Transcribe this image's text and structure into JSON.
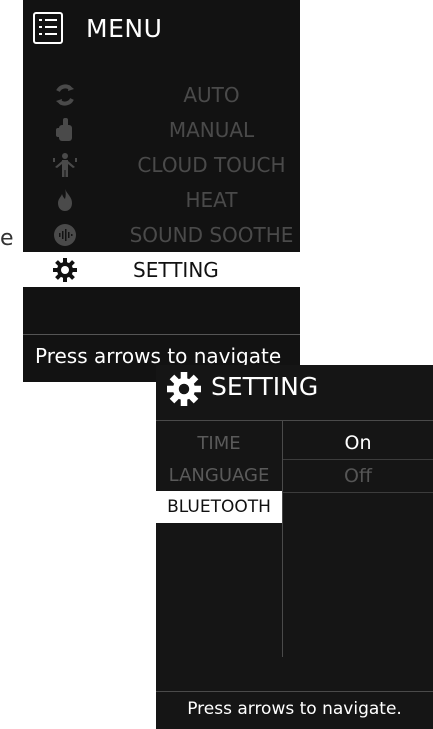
{
  "stray_char": "e",
  "menu": {
    "title": "MENU",
    "icon": "list-icon",
    "items": [
      {
        "label": "AUTO",
        "icon": "refresh-cycle-icon",
        "selected": false
      },
      {
        "label": "MANUAL",
        "icon": "hand-icon",
        "selected": false
      },
      {
        "label": "CLOUD TOUCH",
        "icon": "body-figure-icon",
        "selected": false
      },
      {
        "label": "HEAT",
        "icon": "flame-icon",
        "selected": false
      },
      {
        "label": "SOUND SOOTHE",
        "icon": "sound-wave-icon",
        "selected": false
      },
      {
        "label": "SETTING",
        "icon": "gear-icon",
        "selected": true
      }
    ],
    "footer": "Press arrows to navigate"
  },
  "setting": {
    "title": "SETTING",
    "icon": "gear-icon",
    "options": [
      {
        "label": "TIME",
        "selected": false
      },
      {
        "label": "LANGUAGE",
        "selected": false
      },
      {
        "label": "BLUETOOTH",
        "selected": true
      }
    ],
    "values": [
      {
        "label": "On",
        "active": true
      },
      {
        "label": "Off",
        "active": false
      }
    ],
    "footer": "Press arrows to navigate."
  },
  "colors": {
    "panel_bg": "#121212",
    "selected_bg": "#ffffff",
    "dim_text": "#4a4a4a",
    "text": "#ffffff"
  }
}
